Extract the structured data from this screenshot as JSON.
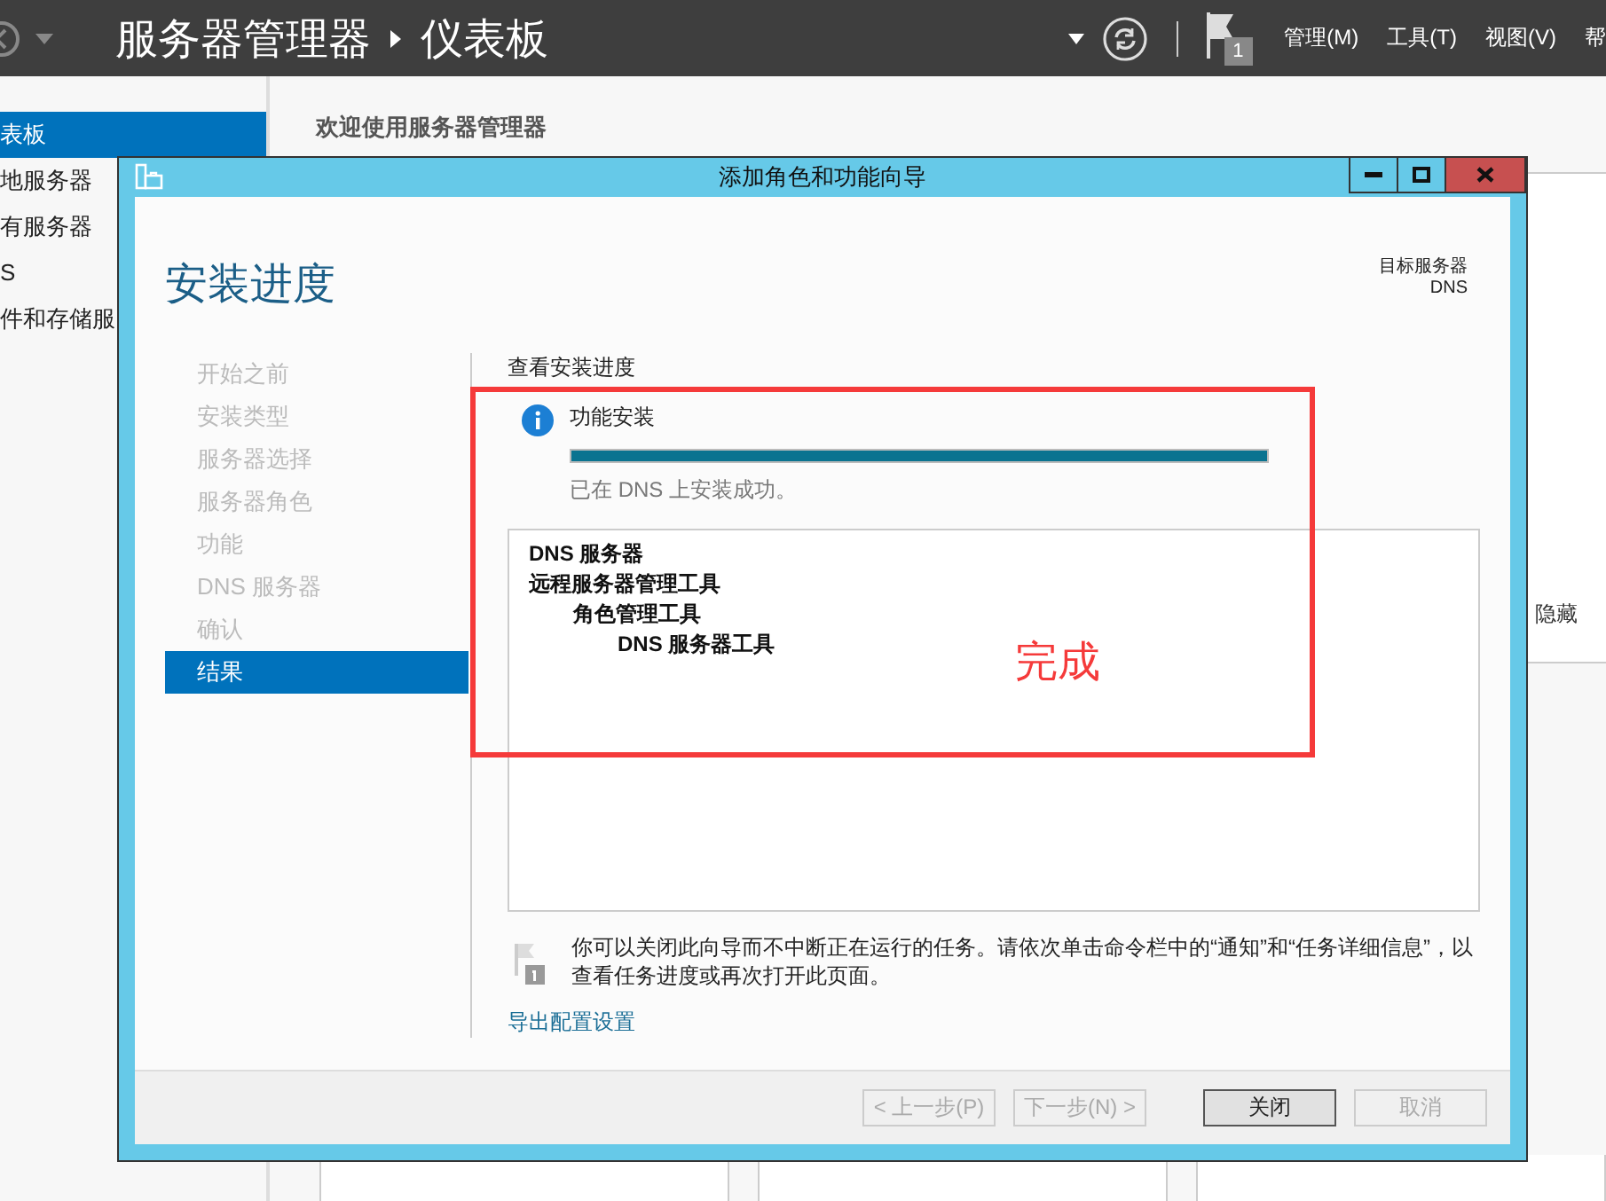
{
  "app": {
    "title": "服务器管理器",
    "page": "仪表板",
    "notification_count": "1",
    "menu": [
      "管理(M)",
      "工具(T)",
      "视图(V)",
      "帮"
    ]
  },
  "sidebar": {
    "items": [
      {
        "label": "表板",
        "selected": true
      },
      {
        "label": "地服务器",
        "selected": false
      },
      {
        "label": "有服务器",
        "selected": false
      },
      {
        "label": "S",
        "selected": false
      },
      {
        "label": "件和存储服",
        "selected": false
      }
    ]
  },
  "dashboard": {
    "welcome": "欢迎使用服务器管理器",
    "hide_link": "隐藏"
  },
  "dialog": {
    "title": "添加角色和功能向导",
    "heading": "安装进度",
    "target_label": "目标服务器",
    "target_server": "DNS",
    "steps": [
      {
        "label": "开始之前",
        "selected": false
      },
      {
        "label": "安装类型",
        "selected": false
      },
      {
        "label": "服务器选择",
        "selected": false
      },
      {
        "label": "服务器角色",
        "selected": false
      },
      {
        "label": "功能",
        "selected": false
      },
      {
        "label": "DNS 服务器",
        "selected": false
      },
      {
        "label": "确认",
        "selected": false
      },
      {
        "label": "结果",
        "selected": true
      }
    ],
    "section_title": "查看安装进度",
    "progress": {
      "title": "功能安装",
      "level": 1,
      "status": "已在 DNS 上安装成功。"
    },
    "results": [
      {
        "label": "DNS 服务器"
      },
      {
        "label": "远程服务器管理工具",
        "children": [
          {
            "label": "角色管理工具",
            "children": [
              {
                "label": "DNS 服务器工具"
              }
            ]
          }
        ]
      }
    ],
    "note": "你可以关闭此向导而不中断正在运行的任务。请依次单击命令栏中的“通知”和“任务详细信息”，以查看任务进度或再次打开此页面。",
    "export_link": "导出配置设置",
    "buttons": [
      {
        "label": "< 上一步(P)",
        "disabled": true,
        "default": false
      },
      {
        "label": "下一步(N) >",
        "disabled": true,
        "default": false
      },
      {
        "label": "关闭",
        "disabled": false,
        "default": true
      },
      {
        "label": "取消",
        "disabled": true,
        "default": false
      }
    ]
  },
  "annotation": {
    "label": "完成"
  }
}
